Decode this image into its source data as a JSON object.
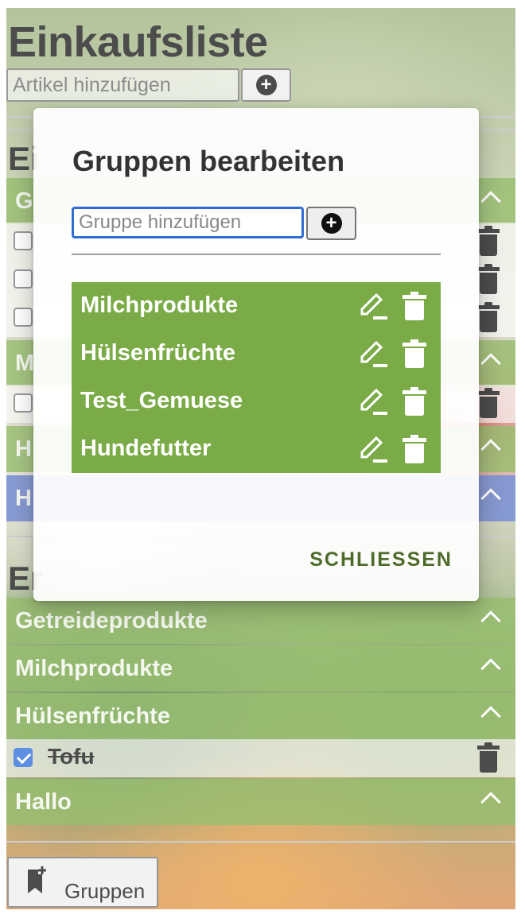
{
  "app": {
    "title": "Einkaufsliste",
    "add_item_placeholder": "Artikel hinzufügen"
  },
  "background": {
    "groups_top": [
      {
        "label": "G",
        "expanded": true
      },
      {
        "label": "M",
        "expanded": true
      },
      {
        "label": "H",
        "expanded": true
      },
      {
        "label": "H",
        "expanded": true,
        "color": "#5670c4"
      }
    ],
    "section_head_top": "Ei",
    "section_head_bottom": "Er",
    "groups_bottom": [
      {
        "label": "Getreideprodukte"
      },
      {
        "label": "Milchprodukte"
      },
      {
        "label": "Hülsenfrüchte"
      },
      {
        "label": "Hallo"
      }
    ],
    "checked_item": {
      "label": "Tofu",
      "checked": true
    },
    "groups_button_label": "Gruppen"
  },
  "dialog": {
    "title": "Gruppen bearbeiten",
    "add_group_placeholder": "Gruppe hinzufügen",
    "groups": [
      {
        "name": "Milchprodukte"
      },
      {
        "name": "Hülsenfrüchte"
      },
      {
        "name": "Test_Gemuese"
      },
      {
        "name": "Hundefutter"
      }
    ],
    "close_label": "SCHLIESSEN"
  },
  "colors": {
    "group_green": "#7aab46",
    "group_blue": "#5670c4",
    "focus_blue": "#2f6cd6",
    "close_text": "#4e6b2a"
  }
}
